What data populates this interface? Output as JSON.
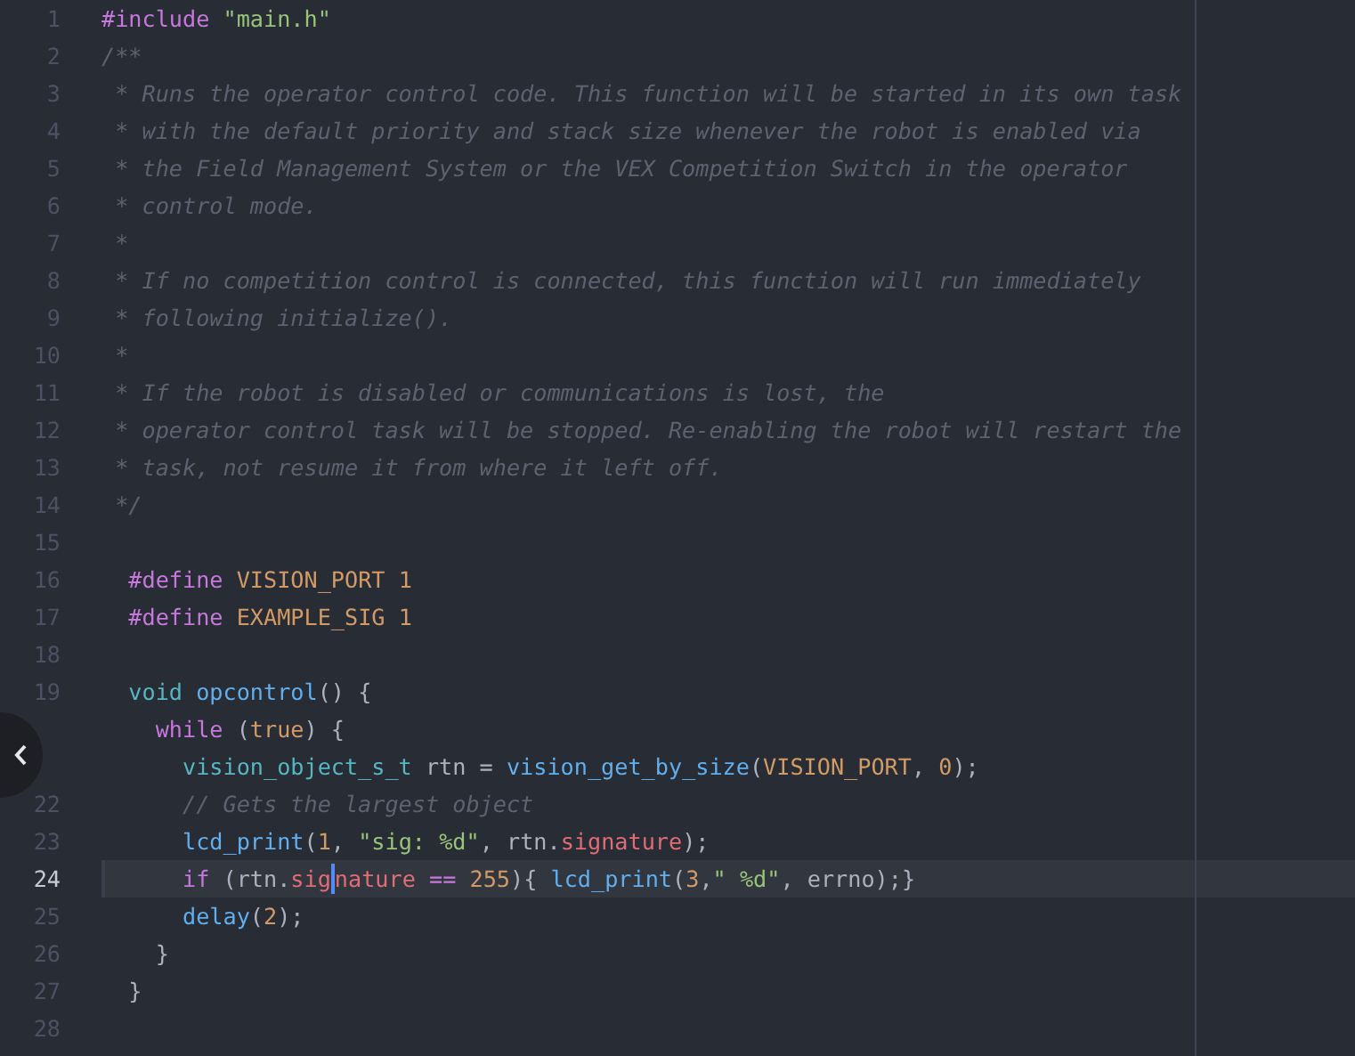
{
  "editor": {
    "lines": [
      {
        "number": "1",
        "current": false,
        "tokens": [
          {
            "kind": "keyword",
            "text": "#include "
          },
          {
            "kind": "string",
            "text": "\"main.h\""
          }
        ]
      },
      {
        "number": "2",
        "current": false,
        "tokens": [
          {
            "kind": "comment",
            "text": "/**"
          }
        ]
      },
      {
        "number": "3",
        "current": false,
        "tokens": [
          {
            "kind": "comment",
            "text": " * Runs the operator control code. This function will be started in its own task"
          }
        ]
      },
      {
        "number": "4",
        "current": false,
        "tokens": [
          {
            "kind": "comment",
            "text": " * with the default priority and stack size whenever the robot is enabled via"
          }
        ]
      },
      {
        "number": "5",
        "current": false,
        "tokens": [
          {
            "kind": "comment",
            "text": " * the Field Management System or the VEX Competition Switch in the operator"
          }
        ]
      },
      {
        "number": "6",
        "current": false,
        "tokens": [
          {
            "kind": "comment",
            "text": " * control mode."
          }
        ]
      },
      {
        "number": "7",
        "current": false,
        "tokens": [
          {
            "kind": "comment",
            "text": " *"
          }
        ]
      },
      {
        "number": "8",
        "current": false,
        "tokens": [
          {
            "kind": "comment",
            "text": " * If no competition control is connected, this function will run immediately"
          }
        ]
      },
      {
        "number": "9",
        "current": false,
        "tokens": [
          {
            "kind": "comment",
            "text": " * following initialize()."
          }
        ]
      },
      {
        "number": "10",
        "current": false,
        "tokens": [
          {
            "kind": "comment",
            "text": " *"
          }
        ]
      },
      {
        "number": "11",
        "current": false,
        "tokens": [
          {
            "kind": "comment",
            "text": " * If the robot is disabled or communications is lost, the"
          }
        ]
      },
      {
        "number": "12",
        "current": false,
        "tokens": [
          {
            "kind": "comment",
            "text": " * operator control task will be stopped. Re-enabling the robot will restart the"
          }
        ]
      },
      {
        "number": "13",
        "current": false,
        "tokens": [
          {
            "kind": "comment",
            "text": " * task, not resume it from where it left off."
          }
        ]
      },
      {
        "number": "14",
        "current": false,
        "tokens": [
          {
            "kind": "comment",
            "text": " */"
          }
        ]
      },
      {
        "number": "15",
        "current": false
      },
      {
        "number": "16",
        "current": false,
        "tokens": [
          {
            "kind": "keyword",
            "text": "  #define "
          },
          {
            "kind": "constant",
            "text": "VISION_PORT 1"
          }
        ]
      },
      {
        "number": "17",
        "current": false,
        "tokens": [
          {
            "kind": "keyword",
            "text": "  #define "
          },
          {
            "kind": "constant",
            "text": "EXAMPLE_SIG 1"
          }
        ]
      },
      {
        "number": "18",
        "current": false
      },
      {
        "number": "19",
        "current": false,
        "tokens": [
          {
            "kind": "type",
            "text": "  void "
          },
          {
            "kind": "function",
            "text": "opcontrol"
          },
          {
            "kind": "plain",
            "text": "() {"
          }
        ]
      },
      {
        "current": false,
        "tokens": [
          {
            "kind": "keyword",
            "text": "    while"
          },
          {
            "kind": "plain",
            "text": " ("
          },
          {
            "kind": "constant",
            "text": "true"
          },
          {
            "kind": "plain",
            "text": ") {"
          }
        ]
      },
      {
        "current": false,
        "tokens": [
          {
            "kind": "type",
            "text": "      vision_object_s_t"
          },
          {
            "kind": "plain",
            "text": " rtn = "
          },
          {
            "kind": "function",
            "text": "vision_get_by_size"
          },
          {
            "kind": "plain",
            "text": "("
          },
          {
            "kind": "constant",
            "text": "VISION_PORT"
          },
          {
            "kind": "plain",
            "text": ", "
          },
          {
            "kind": "constant",
            "text": "0"
          },
          {
            "kind": "plain",
            "text": ");"
          }
        ]
      },
      {
        "number": "22",
        "current": false,
        "tokens": [
          {
            "kind": "comment",
            "text": "      // Gets the largest object"
          }
        ]
      },
      {
        "number": "23",
        "current": false,
        "tokens": [
          {
            "kind": "function",
            "text": "      lcd_print"
          },
          {
            "kind": "plain",
            "text": "("
          },
          {
            "kind": "constant",
            "text": "1"
          },
          {
            "kind": "plain",
            "text": ", "
          },
          {
            "kind": "string",
            "text": "\"sig: %d\""
          },
          {
            "kind": "plain",
            "text": ", rtn."
          },
          {
            "kind": "property",
            "text": "signature"
          },
          {
            "kind": "plain",
            "text": ");"
          }
        ]
      },
      {
        "number": "24",
        "current": true,
        "tokens": [
          {
            "kind": "keyword",
            "text": "      if"
          },
          {
            "kind": "plain",
            "text": " (rtn."
          },
          {
            "kind": "property",
            "text": "sig"
          },
          {
            "kind": "cursor"
          },
          {
            "kind": "property",
            "text": "nature"
          },
          {
            "kind": "operator",
            "text": " == "
          },
          {
            "kind": "constant",
            "text": "255"
          },
          {
            "kind": "plain",
            "text": "){ "
          },
          {
            "kind": "function",
            "text": "lcd_print"
          },
          {
            "kind": "plain",
            "text": "("
          },
          {
            "kind": "constant",
            "text": "3"
          },
          {
            "kind": "plain",
            "text": ","
          },
          {
            "kind": "string",
            "text": "\" %d\""
          },
          {
            "kind": "plain",
            "text": ", errno);}"
          }
        ]
      },
      {
        "number": "25",
        "current": false,
        "tokens": [
          {
            "kind": "function",
            "text": "      delay"
          },
          {
            "kind": "plain",
            "text": "("
          },
          {
            "kind": "constant",
            "text": "2"
          },
          {
            "kind": "plain",
            "text": ");"
          }
        ]
      },
      {
        "number": "26",
        "current": false,
        "tokens": [
          {
            "kind": "plain",
            "text": "    }"
          }
        ]
      },
      {
        "number": "27",
        "current": false,
        "tokens": [
          {
            "kind": "plain",
            "text": "  }"
          }
        ]
      },
      {
        "number": "28",
        "current": false
      }
    ]
  }
}
